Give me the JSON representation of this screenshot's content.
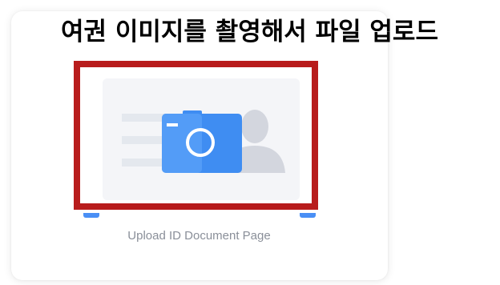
{
  "annotation": {
    "title": "여권 이미지를 촬영해서 파일 업로드"
  },
  "upload": {
    "label": "Upload ID Document Page"
  },
  "colors": {
    "highlight_border": "#b81c1c",
    "tile_background": "#f4f5f8",
    "camera_blue": "#3f8df2",
    "camera_blue_light": "#65a9fb",
    "silhouette": "#d3d6de",
    "speed_lines": "#e4e8ee",
    "label_text": "#8a8f99"
  },
  "icons": {
    "camera": "camera-icon",
    "person": "person-silhouette-icon"
  }
}
